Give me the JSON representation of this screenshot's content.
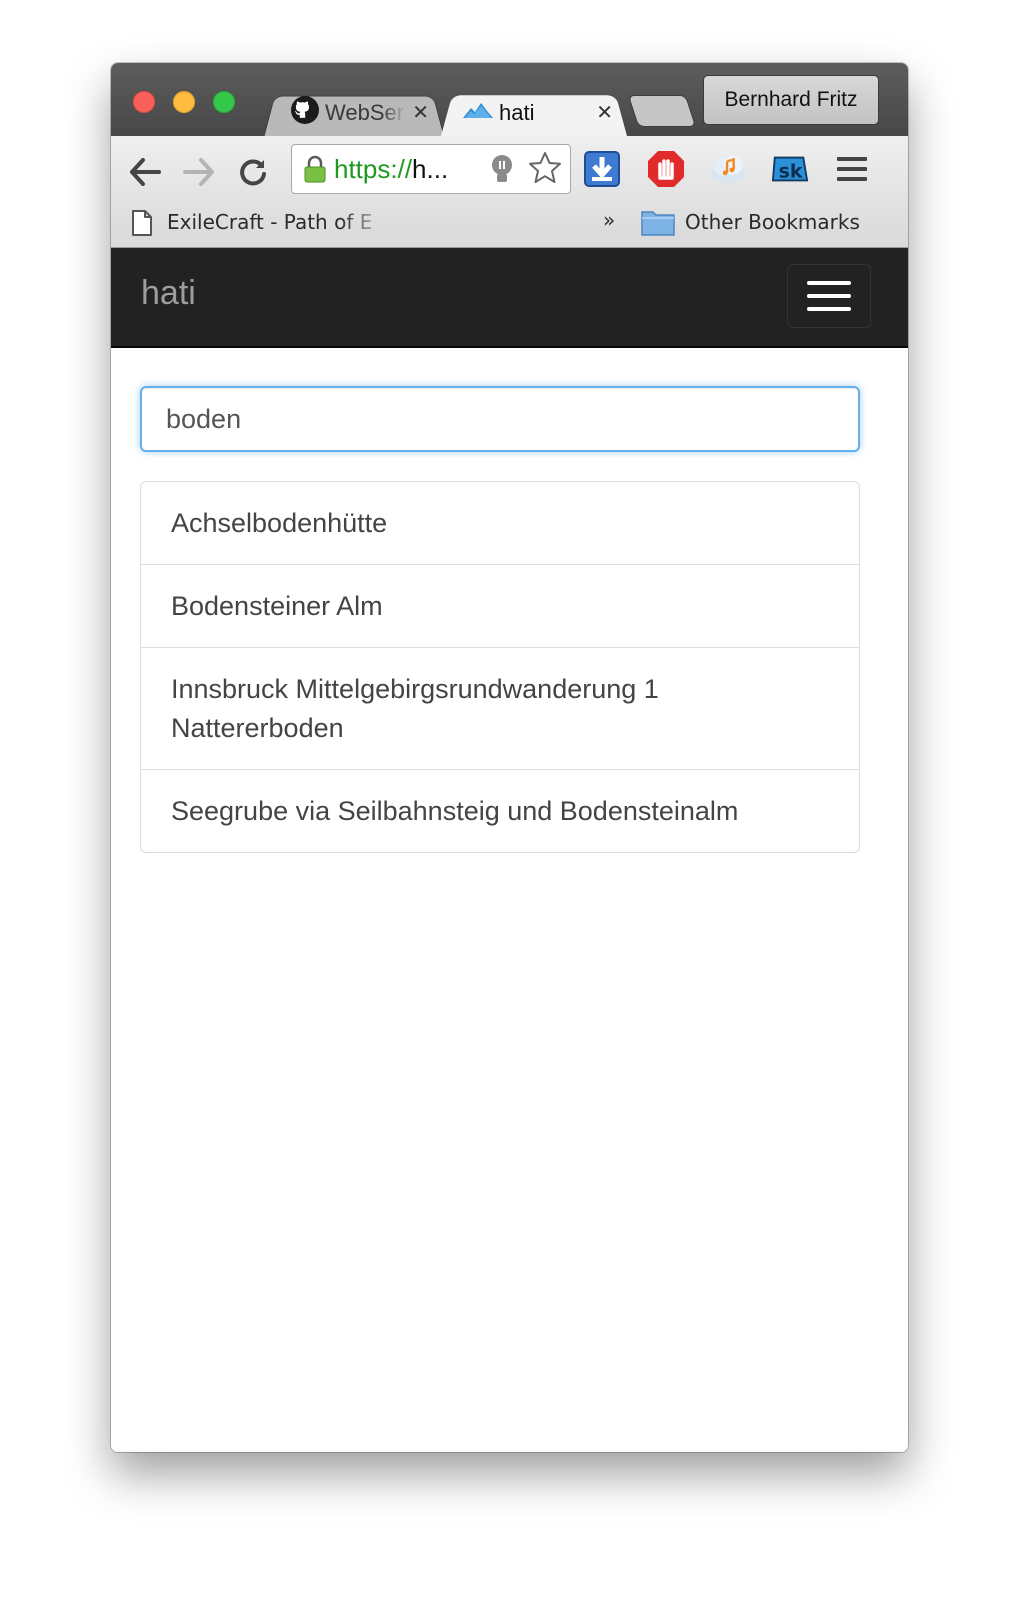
{
  "browser": {
    "tabs": [
      {
        "title": "WebSer",
        "icon": "github-icon",
        "active": false
      },
      {
        "title": "hati",
        "icon": "mountain-icon",
        "active": true
      }
    ],
    "profile_name": "Bernhard Fritz",
    "url": {
      "scheme": "https://",
      "rest": "h..."
    },
    "bookmarks": {
      "first": "ExileCraft - Path of E",
      "overflow": "»",
      "other": "Other Bookmarks"
    },
    "extensions": [
      "download-icon",
      "adblock-hand-icon",
      "music-cloud-icon",
      "sk-icon",
      "menu-icon"
    ]
  },
  "navbar": {
    "brand": "hati"
  },
  "search": {
    "value": "boden"
  },
  "results": [
    "Achselbodenhütte",
    "Bodensteiner Alm",
    "Innsbruck Mittelgebirgsrundwanderung 1 Natterer­boden",
    "Seegrube via Seilbahnsteig und Bodensteinalm"
  ],
  "colors": {
    "navbar": "#222222",
    "brand": "#9d9d9d",
    "focus_border": "#66afe9",
    "secure_green": "#1f9a1f"
  }
}
